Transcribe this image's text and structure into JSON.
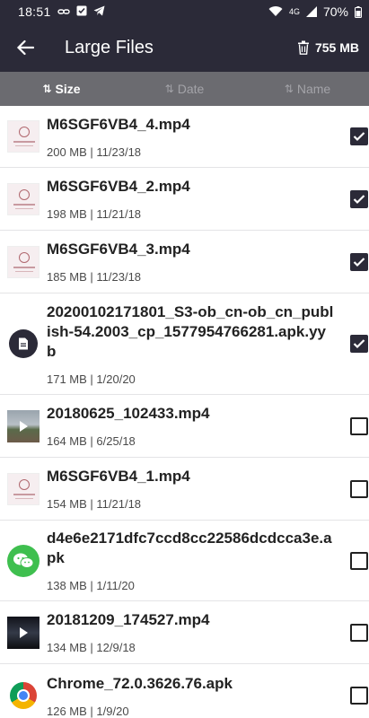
{
  "status_bar": {
    "time": "18:51",
    "battery": "70%",
    "network": "4G",
    "left_icons": [
      "link-icon",
      "checkbox-notification-icon",
      "telegram-icon"
    ],
    "right_icons": [
      "wifi-icon",
      "signal-icon",
      "battery-icon"
    ]
  },
  "app_bar": {
    "title": "Large Files",
    "total_size": "755 MB"
  },
  "sort_tabs": [
    {
      "label": "Size",
      "active": true
    },
    {
      "label": "Date",
      "active": false
    },
    {
      "label": "Name",
      "active": false
    }
  ],
  "files": [
    {
      "name": "M6SGF6VB4_4.mp4",
      "meta": "200 MB | 11/23/18",
      "checked": true,
      "thumb": "pink-thumbnail"
    },
    {
      "name": "M6SGF6VB4_2.mp4",
      "meta": "198 MB | 11/21/18",
      "checked": true,
      "thumb": "pink-thumbnail"
    },
    {
      "name": "M6SGF6VB4_3.mp4",
      "meta": "185 MB | 11/23/18",
      "checked": true,
      "thumb": "pink-thumbnail"
    },
    {
      "name": "20200102171801_S3-ob_cn-ob_cn_publish-54.2003_cp_1577954766281.apk.yyb",
      "meta": "171 MB | 1/20/20",
      "checked": true,
      "thumb": "document-icon"
    },
    {
      "name": "20180625_102433.mp4",
      "meta": "164 MB | 6/25/18",
      "checked": false,
      "thumb": "video-thumbnail-landscape"
    },
    {
      "name": "M6SGF6VB4_1.mp4",
      "meta": "154 MB | 11/21/18",
      "checked": false,
      "thumb": "pink-thumbnail"
    },
    {
      "name": "d4e6e2171dfc7ccd8cc22586dcdcca3e.apk",
      "meta": "138 MB | 1/11/20",
      "checked": false,
      "thumb": "wechat-icon"
    },
    {
      "name": "20181209_174527.mp4",
      "meta": "134 MB | 12/9/18",
      "checked": false,
      "thumb": "video-thumbnail-storm"
    },
    {
      "name": "Chrome_72.0.3626.76.apk",
      "meta": "126 MB | 1/9/20",
      "checked": false,
      "thumb": "chrome-icon"
    }
  ],
  "colors": {
    "header_bg": "#2b2a38",
    "sort_bar_bg": "#6b6b70",
    "checkbox_checked": "#2b2a38"
  }
}
